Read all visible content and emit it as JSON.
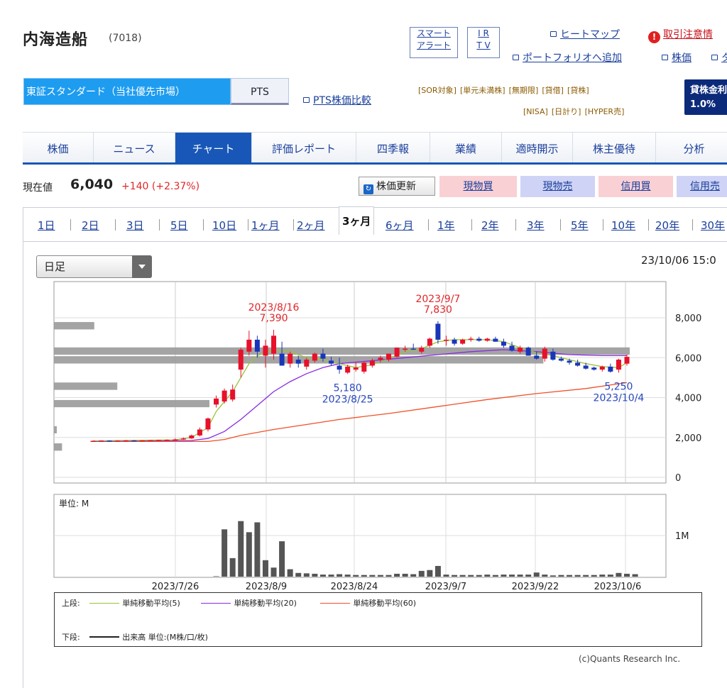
{
  "header": {
    "title": "内海造船",
    "code": "(7018)",
    "smart_alert_1": "スマート",
    "smart_alert_2": "アラート",
    "ir": "I R",
    "tv": "T V",
    "heatmap": "ヒートマップ",
    "caution": "取引注意情",
    "portfolio": "ポートフォリオへ追加",
    "kabuka": "株価",
    "more": "タ"
  },
  "market": {
    "primary": "東証スタンダード（当社優先市場）",
    "pts": "PTS",
    "pts_compare": "PTS株価比較"
  },
  "tags": {
    "row1": [
      "[SOR対象]",
      "[単元未満株]",
      "[無期限]",
      "[貸借]",
      "[貸株]"
    ],
    "row2": [
      "[NISA]",
      "[日計り]",
      "[HYPER売]"
    ]
  },
  "lending": {
    "label": "貸株金利",
    "rate": "1.0%"
  },
  "tabs": [
    "株価",
    "ニュース",
    "チャート",
    "評価レポート",
    "四季報",
    "業績",
    "適時開示",
    "株主優待",
    "分析"
  ],
  "active_tab": "チャート",
  "quote": {
    "label": "現在値",
    "price": "6,040",
    "change": "+140",
    "change_pct": "(+2.37%)"
  },
  "buttons": {
    "refresh": "株価更新",
    "buy_spot": "現物買",
    "sell_spot": "現物売",
    "buy_margin": "信用買",
    "sell_margin": "信用売"
  },
  "colors": {
    "buy": "#f9d0d4",
    "sell": "#cfd3f5",
    "up": "#e8102a",
    "down": "#1a36b8",
    "ma5": "#9ac33a",
    "ma20": "#8a2be2",
    "ma60": "#f05028"
  },
  "periods": [
    "1日",
    "2日",
    "3日",
    "5日",
    "10日",
    "1ヶ月",
    "2ヶ月",
    "3ヶ月",
    "6ヶ月",
    "1年",
    "2年",
    "3年",
    "5年",
    "10年",
    "20年",
    "30年"
  ],
  "active_period": "3ヶ月",
  "interval_select": "日足",
  "timestamp": "23/10/06 15:0",
  "chart_data": {
    "type": "candlestick",
    "y_ticks": [
      "8,000",
      "6,000",
      "4,000",
      "2,000",
      "0"
    ],
    "ylim": [
      0,
      8800
    ],
    "x_ticks": [
      "2023/7/26",
      "2023/8/9",
      "2023/8/24",
      "2023/9/7",
      "2023/9/22",
      "2023/10/6"
    ],
    "annotations": [
      {
        "date": "2023/8/16",
        "price": "7,390",
        "kind": "high"
      },
      {
        "date": "2023/9/7",
        "price": "7,830",
        "kind": "high"
      },
      {
        "date": "2023/8/25",
        "price": "5,180",
        "kind": "low"
      },
      {
        "date": "2023/10/4",
        "price": "5,250",
        "kind": "low"
      }
    ],
    "candles": [
      [
        1820,
        1850,
        1800,
        1830
      ],
      [
        1830,
        1850,
        1810,
        1840
      ],
      [
        1840,
        1860,
        1820,
        1830
      ],
      [
        1830,
        1850,
        1810,
        1840
      ],
      [
        1840,
        1870,
        1820,
        1850
      ],
      [
        1850,
        1870,
        1830,
        1840
      ],
      [
        1840,
        1860,
        1820,
        1850
      ],
      [
        1850,
        1870,
        1830,
        1860
      ],
      [
        1860,
        1880,
        1840,
        1870
      ],
      [
        1870,
        1900,
        1850,
        1880
      ],
      [
        1880,
        1950,
        1860,
        1900
      ],
      [
        1900,
        2000,
        1880,
        1950
      ],
      [
        1950,
        2150,
        1930,
        2100
      ],
      [
        2100,
        2500,
        2050,
        2400
      ],
      [
        2400,
        3000,
        2300,
        2950
      ],
      [
        3650,
        4100,
        3500,
        3950
      ],
      [
        3800,
        4450,
        3700,
        4350
      ],
      [
        3900,
        4650,
        3800,
        4400
      ],
      [
        5400,
        6500,
        5000,
        6400
      ],
      [
        6300,
        7350,
        6100,
        6900
      ],
      [
        6900,
        7100,
        6000,
        6300
      ],
      [
        6100,
        6900,
        5500,
        6600
      ],
      [
        6200,
        7400,
        5900,
        7100
      ],
      [
        6200,
        6800,
        5600,
        5600
      ],
      [
        5700,
        6300,
        5500,
        6200
      ],
      [
        5900,
        6100,
        5500,
        5700
      ],
      [
        5550,
        6000,
        5400,
        5900
      ],
      [
        5850,
        6250,
        5750,
        6200
      ],
      [
        6200,
        6450,
        5800,
        5950
      ],
      [
        5850,
        6050,
        5600,
        5700
      ],
      [
        5600,
        6000,
        5200,
        5400
      ],
      [
        5250,
        5650,
        5180,
        5550
      ],
      [
        5400,
        5800,
        5300,
        5500
      ],
      [
        5300,
        5800,
        5200,
        5750
      ],
      [
        5600,
        5950,
        5500,
        5850
      ],
      [
        5900,
        6100,
        5750,
        6000
      ],
      [
        5900,
        6200,
        5800,
        6200
      ],
      [
        6050,
        6500,
        6000,
        6500
      ],
      [
        6400,
        6600,
        6300,
        6450
      ],
      [
        6450,
        6700,
        6400,
        6400
      ],
      [
        6300,
        6600,
        6200,
        6500
      ],
      [
        6600,
        7000,
        6500,
        6950
      ],
      [
        7700,
        7830,
        6700,
        6900
      ],
      [
        6850,
        7100,
        6600,
        6900
      ],
      [
        6900,
        7000,
        6600,
        6700
      ],
      [
        6700,
        6950,
        6650,
        6900
      ],
      [
        6900,
        7050,
        6800,
        6950
      ],
      [
        6950,
        7050,
        6800,
        6850
      ],
      [
        6850,
        7000,
        6800,
        6950
      ],
      [
        6950,
        7050,
        6800,
        6800
      ],
      [
        6800,
        6950,
        6500,
        6600
      ],
      [
        6600,
        6800,
        6300,
        6350
      ],
      [
        6300,
        6600,
        6200,
        6500
      ],
      [
        6500,
        6550,
        6300,
        6100
      ],
      [
        6100,
        6300,
        5900,
        5950
      ],
      [
        5950,
        6550,
        5800,
        6450
      ],
      [
        6300,
        6450,
        5850,
        5900
      ],
      [
        5950,
        6050,
        5800,
        5850
      ],
      [
        5850,
        5950,
        5650,
        5750
      ],
      [
        5750,
        5900,
        5550,
        5600
      ],
      [
        5600,
        5750,
        5400,
        5450
      ],
      [
        5500,
        5550,
        5350,
        5400
      ],
      [
        5400,
        5600,
        5300,
        5550
      ],
      [
        5550,
        5700,
        5250,
        5300
      ],
      [
        5400,
        5950,
        5250,
        5900
      ],
      [
        5700,
        6150,
        5600,
        6040
      ]
    ],
    "ma5": [
      [
        0,
        1830
      ],
      [
        10,
        1880
      ],
      [
        12,
        2000
      ],
      [
        14,
        2500
      ],
      [
        15,
        3300
      ],
      [
        16,
        3800
      ],
      [
        17,
        4300
      ],
      [
        18,
        5000
      ],
      [
        19,
        5700
      ],
      [
        20,
        6100
      ],
      [
        22,
        6400
      ],
      [
        24,
        6300
      ],
      [
        26,
        6000
      ],
      [
        28,
        5900
      ],
      [
        30,
        5700
      ],
      [
        32,
        5500
      ],
      [
        34,
        5650
      ],
      [
        36,
        5950
      ],
      [
        38,
        6300
      ],
      [
        40,
        6450
      ],
      [
        42,
        6800
      ],
      [
        44,
        6900
      ],
      [
        46,
        6900
      ],
      [
        48,
        6900
      ],
      [
        50,
        6800
      ],
      [
        52,
        6500
      ],
      [
        54,
        6250
      ],
      [
        56,
        6100
      ],
      [
        58,
        5900
      ],
      [
        60,
        5700
      ],
      [
        62,
        5550
      ],
      [
        64,
        5500
      ],
      [
        65,
        5750
      ]
    ],
    "ma20": [
      [
        0,
        1800
      ],
      [
        12,
        1850
      ],
      [
        14,
        1950
      ],
      [
        16,
        2300
      ],
      [
        18,
        2900
      ],
      [
        20,
        3600
      ],
      [
        22,
        4300
      ],
      [
        24,
        4800
      ],
      [
        26,
        5200
      ],
      [
        28,
        5500
      ],
      [
        30,
        5700
      ],
      [
        34,
        5850
      ],
      [
        38,
        6000
      ],
      [
        42,
        6150
      ],
      [
        46,
        6300
      ],
      [
        50,
        6400
      ],
      [
        54,
        6300
      ],
      [
        58,
        6150
      ],
      [
        62,
        6100
      ],
      [
        65,
        6100
      ]
    ],
    "ma60": [
      [
        0,
        1800
      ],
      [
        14,
        1800
      ],
      [
        16,
        1900
      ],
      [
        18,
        2100
      ],
      [
        22,
        2400
      ],
      [
        26,
        2650
      ],
      [
        30,
        2900
      ],
      [
        36,
        3200
      ],
      [
        42,
        3550
      ],
      [
        48,
        3900
      ],
      [
        54,
        4200
      ],
      [
        60,
        4450
      ],
      [
        65,
        4750
      ]
    ],
    "volume_unit": "単位: M",
    "volume_ticks": [
      "1M"
    ],
    "volume_max_m": 1.6,
    "volume_m": [
      0,
      0,
      0,
      0,
      0,
      0,
      0,
      0,
      0,
      0,
      0,
      0,
      0,
      0,
      0,
      0.01,
      1.15,
      0.45,
      1.35,
      1.08,
      1.32,
      0.4,
      0.22,
      0.86,
      0.18,
      0.09,
      0.08,
      0.07,
      0.05,
      0.05,
      0.06,
      0.05,
      0.04,
      0.04,
      0.04,
      0.04,
      0.04,
      0.07,
      0.07,
      0.06,
      0.14,
      0.16,
      0.26,
      0.05,
      0.04,
      0.04,
      0.04,
      0.04,
      0.05,
      0.04,
      0.05,
      0.05,
      0.05,
      0.05,
      0.1,
      0.05,
      0.03,
      0.04,
      0.04,
      0.04,
      0.04,
      0.04,
      0.05,
      0.05,
      0.09,
      0.07,
      0.06
    ],
    "price_volume_bins": [
      {
        "price_from": 7380,
        "price_to": 7820,
        "volume": 0.07
      },
      {
        "price_from": 6110,
        "price_to": 6550,
        "volume": 1.0
      },
      {
        "price_from": 5670,
        "price_to": 6110,
        "volume": 0.85
      },
      {
        "price_from": 4350,
        "price_to": 4790,
        "volume": 0.11
      },
      {
        "price_from": 3480,
        "price_to": 3910,
        "volume": 0.27
      },
      {
        "price_from": 2170,
        "price_to": 2600,
        "volume": 0.005
      },
      {
        "price_from": 1300,
        "price_to": 1740,
        "volume": 0.014
      }
    ]
  },
  "legend": {
    "upper_label": "上段:",
    "ma5": "単純移動平均(5)",
    "ma20": "単純移動平均(20)",
    "ma60": "単純移動平均(60)",
    "lower_label": "下段:",
    "volume": "出来高 単位:(M株/口/枚)"
  },
  "copyright": "(c)Quants Research Inc."
}
